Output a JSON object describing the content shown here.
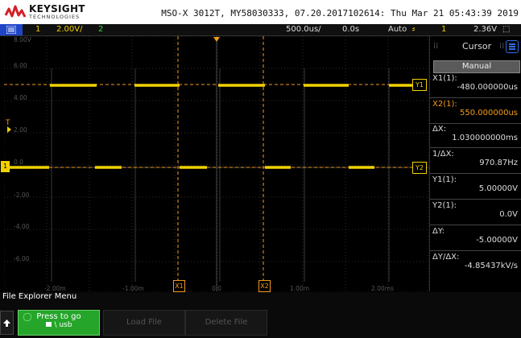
{
  "header": {
    "brand": "KEYSIGHT",
    "brand_sub": "TECHNOLOGIES",
    "model_info": "MSO-X 3012T, MY58030333, 07.20.2017102614: Thu Mar 21 05:43:39 2019"
  },
  "status": {
    "channel": "1",
    "volts_div": "2.00V/",
    "channel2": "2",
    "time_div": "500.0us/",
    "delay": "0.0s",
    "trigger_mode": "Auto",
    "trigger_channel": "1",
    "trigger_level": "2.36V"
  },
  "grid": {
    "y_labels": [
      "8.00V",
      "6.00",
      "4.00",
      "2.00",
      "0.0",
      "-2.00",
      "-4.00",
      "-6.00"
    ],
    "x_labels": [
      "-2.00m",
      "-1.00m",
      "0.0",
      "1.00m",
      "2.00ms"
    ],
    "marker_x1": "X1",
    "marker_x2": "X2",
    "marker_y1": "Y1",
    "marker_y2": "Y2",
    "trigger_marker": "T",
    "ground_marker": "1",
    "trace_color": "#f1d100",
    "cursor_x1_color": "#f39a1e",
    "cursor_x2_color": "#f39a1e"
  },
  "cursor_panel": {
    "title": "Cursor",
    "mode": "Manual",
    "x1_label": "X1(1):",
    "x1_value": "-480.000000us",
    "x2_label": "X2(1):",
    "x2_value": "550.000000us",
    "dx_label": "ΔX:",
    "dx_value": "1.030000000ms",
    "inv_dx_label": "1/ΔX:",
    "inv_dx_value": "970.87Hz",
    "y1_label": "Y1(1):",
    "y1_value": "5.00000V",
    "y2_label": "Y2(1):",
    "y2_value": "0.0V",
    "dy_label": "ΔY:",
    "dy_value": "-5.00000V",
    "dydx_label": "ΔY/ΔX:",
    "dydx_value": "-4.85437kV/s"
  },
  "footer": {
    "menu_title": "File Explorer Menu",
    "press_go": "Press to go",
    "usb_label": "\\ usb",
    "load_file": "Load File",
    "delete_file": "Delete File"
  }
}
